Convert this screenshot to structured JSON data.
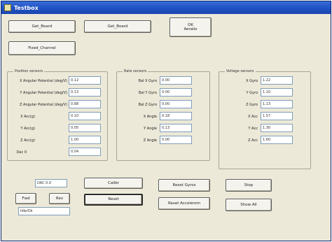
{
  "window": {
    "title": "Testbox"
  },
  "top_buttons": {
    "btn1": "Get_Board",
    "btn2": "Get_Board",
    "btn3_line1": "OK",
    "btn3_line2": "Aeralio",
    "btn4": "Fixed_Channel"
  },
  "groups": {
    "position": {
      "title": "Position sensors",
      "rows": [
        {
          "label": "X Angular Potential (deg/V)",
          "value": "0.12"
        },
        {
          "label": "Y Angular Potential (deg/V)",
          "value": "0.13"
        },
        {
          "label": "Z Angular Potential (deg/V)",
          "value": "0.88"
        },
        {
          "label": "X Acc(g)",
          "value": "0.10"
        },
        {
          "label": "Y Acc(g)",
          "value": "0.05"
        },
        {
          "label": "Z Acc(g)",
          "value": "1.00"
        },
        {
          "label": "Dac 0",
          "value": "0.04"
        }
      ]
    },
    "rate": {
      "title": "Rate sensors",
      "rows": [
        {
          "label": "Bal X Gyro",
          "value": "0.00"
        },
        {
          "label": "Bal Y Gyro",
          "value": "0.00"
        },
        {
          "label": "Bal Z Gyro",
          "value": "0.00"
        },
        {
          "label": "X Angle",
          "value": "0.18"
        },
        {
          "label": "Y Angle",
          "value": "0.13"
        },
        {
          "label": "Z Angle",
          "value": "0.00"
        }
      ]
    },
    "voltage": {
      "title": "Voltage sensors",
      "rows": [
        {
          "label": "X Gyro",
          "value": "1.22"
        },
        {
          "label": "Y Gyro",
          "value": "1.10"
        },
        {
          "label": "Z Gyro",
          "value": "1.13"
        },
        {
          "label": "X Acc",
          "value": "1.57"
        },
        {
          "label": "Y Acc",
          "value": "1.30"
        },
        {
          "label": "Z Acc",
          "value": "1.60"
        }
      ]
    }
  },
  "bottom": {
    "small_field": "DAC 0.0",
    "btn_fwd": "Fwd",
    "btn_rev": "Rev",
    "status_field": "Idle/Ok",
    "btn_cal": "Calibr",
    "btn_reset": "Reset",
    "btn_reset_gyros": "Reset Gyros",
    "btn_reset_accels": "Reset Accelerom",
    "btn_stop": "Stop",
    "btn_show_all": "Show All"
  }
}
